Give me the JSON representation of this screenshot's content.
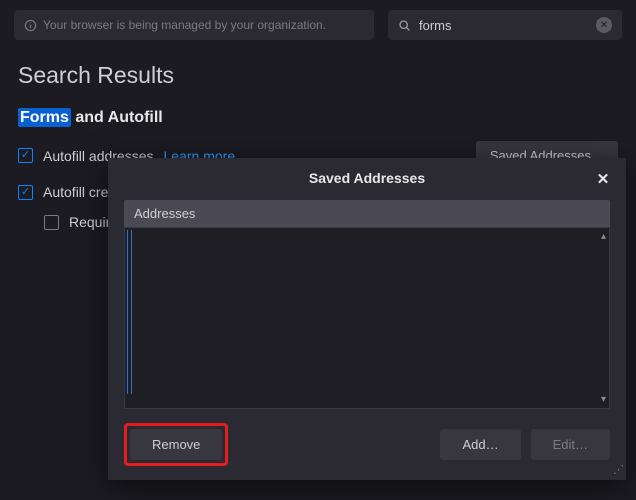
{
  "top": {
    "managed_text": "Your browser is being managed by your organization.",
    "search_value": "forms"
  },
  "heading": "Search Results",
  "section": {
    "title_highlight": "Forms",
    "title_rest": " and Autofill",
    "autofill_addresses_label": "Autofill addresses",
    "learn_more": "Learn more",
    "saved_addresses_btn": "Saved Addresses…",
    "autofill_credit_label": "Autofill credi",
    "require_label": "Require "
  },
  "modal": {
    "title": "Saved Addresses",
    "list_header": "Addresses",
    "items": [],
    "remove_btn": "Remove",
    "add_btn": "Add…",
    "edit_btn": "Edit…"
  }
}
